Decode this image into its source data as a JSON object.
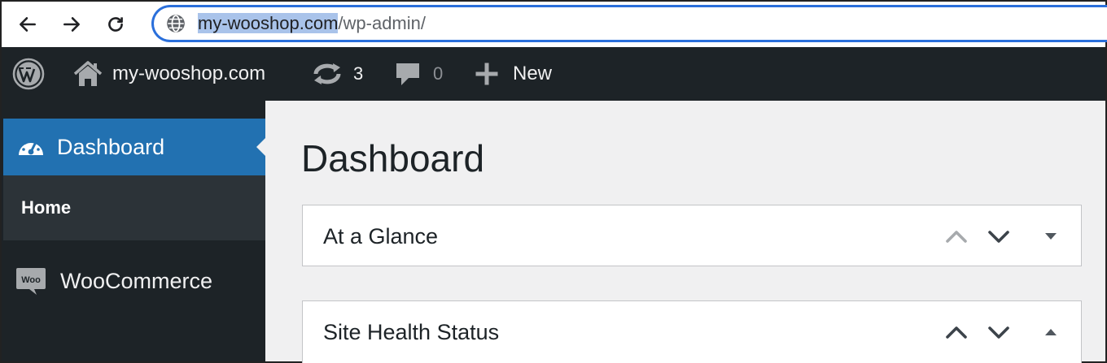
{
  "browser": {
    "url_highlighted": "my-wooshop.com",
    "url_rest": "/wp-admin/"
  },
  "admin_bar": {
    "site_name": "my-wooshop.com",
    "updates_count": "3",
    "comments_count": "0",
    "new_label": "New"
  },
  "sidebar": {
    "dashboard_label": "Dashboard",
    "submenu_home_label": "Home",
    "woocommerce_label": "WooCommerce",
    "woo_icon_text": "Woo"
  },
  "main": {
    "page_title": "Dashboard",
    "widgets": [
      {
        "title": "At a Glance"
      },
      {
        "title": "Site Health Status"
      }
    ]
  },
  "colors": {
    "admin_bar_bg": "#1d2327",
    "active_menu_bg": "#2271b1",
    "submenu_bg": "#2c3338",
    "content_bg": "#f0f0f1",
    "url_selection": "#a9c3ea",
    "address_focus_border": "#2a6fdb"
  },
  "icons": {
    "back": "arrow-left-icon",
    "forward": "arrow-right-icon",
    "reload": "reload-icon",
    "site_info": "globe-icon",
    "wp_logo": "wordpress-logo-icon",
    "home": "home-icon",
    "updates": "updates-icon",
    "comments": "comment-icon",
    "new": "plus-icon",
    "dashboard": "dashboard-gauge-icon",
    "woocommerce": "woo-icon"
  }
}
